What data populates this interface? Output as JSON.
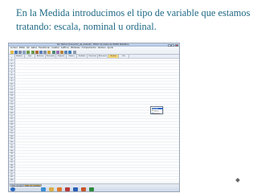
{
  "slide": {
    "caption": "En la Medida introducimos el tipo de variable que estamos tratando: escala, nominal u ordinal.",
    "caption_color": "#1f6a86"
  },
  "window": {
    "title": "Sin título1 [Conjunto_de_datos0] - Editor de datos de PASW Statistics",
    "menu": [
      "Archivo",
      "Editar",
      "Ver",
      "Datos",
      "Transformar",
      "Analizar",
      "Gráficos",
      "Utilidades",
      "Complementos",
      "Ventana",
      "Ayuda"
    ],
    "toolbar_icons": [
      "open-icon",
      "save-icon",
      "print-icon",
      "recall-dialog-icon",
      "undo-icon",
      "redo-icon",
      "goto-case-icon",
      "variables-icon",
      "find-icon",
      "insert-case-icon",
      "insert-variable-icon",
      "split-file-icon",
      "weight-cases-icon",
      "select-cases-icon",
      "value-labels-icon",
      "use-sets-icon"
    ],
    "columns": [
      "Nombre",
      "Tipo",
      "Anchura",
      "Decimales",
      "Etiqueta",
      "Valores",
      "Perdidos",
      "Columnas",
      "Alineación",
      "Medida",
      "Rol"
    ],
    "active_column": "Medida",
    "rows": [
      "1",
      "2",
      "3",
      "4",
      "5",
      "6",
      "7",
      "8",
      "9",
      "10",
      "11",
      "12",
      "13",
      "14",
      "15",
      "16",
      "17",
      "18",
      "19",
      "20",
      "21",
      "22",
      "23",
      "24",
      "25",
      "26",
      "27",
      "28",
      "29",
      "30",
      "31",
      "32",
      "33",
      "34",
      "35",
      "36",
      "37",
      "38",
      "39",
      "40",
      "41",
      "42",
      "43"
    ],
    "measure_dropdown": {
      "options": [
        "Escala",
        "Ordinal",
        "Nominal"
      ],
      "selected": "Escala",
      "icon_colors": [
        "#d9a521",
        "#5b8a2e",
        "#3a6fb0"
      ]
    },
    "tabs": {
      "data_view": "Vista de datos",
      "variable_view": "Vista de variables"
    },
    "taskbar_icons": [
      "start-orb-icon",
      "ie-icon",
      "explorer-icon",
      "media-icon",
      "spss-icon",
      "word-icon",
      "powerpoint-icon",
      "excel-icon"
    ]
  }
}
